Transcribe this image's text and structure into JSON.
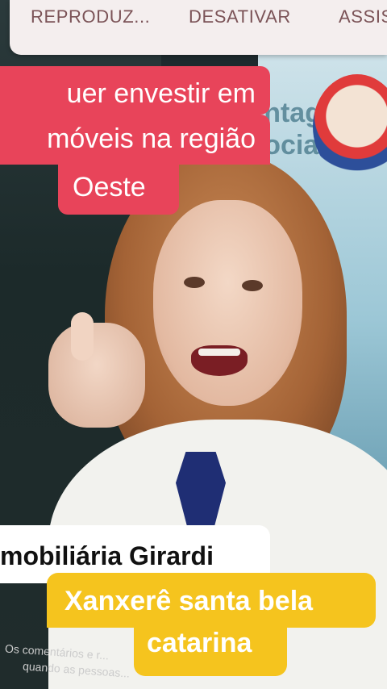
{
  "topbar": {
    "tabs": [
      {
        "label": "REPRODUZ..."
      },
      {
        "label": "DESATIVAR"
      },
      {
        "label": "ASSIS"
      }
    ]
  },
  "captions": {
    "headline": [
      "uer  envestir  em",
      "móveis na região",
      "Oeste"
    ],
    "company": "mobiliária Girardi",
    "location": [
      "Xanxerê santa bela",
      "catarina"
    ]
  },
  "background_text": {
    "poster": [
      "ntag",
      "ociad"
    ],
    "comments": [
      "Os comentários e r...",
      "quando as pessoas..."
    ]
  },
  "colors": {
    "headline_bg": "#e8445a",
    "company_bg": "#ffffff",
    "location_bg": "#f5c41e",
    "topbar_bg": "#f4eeee"
  }
}
